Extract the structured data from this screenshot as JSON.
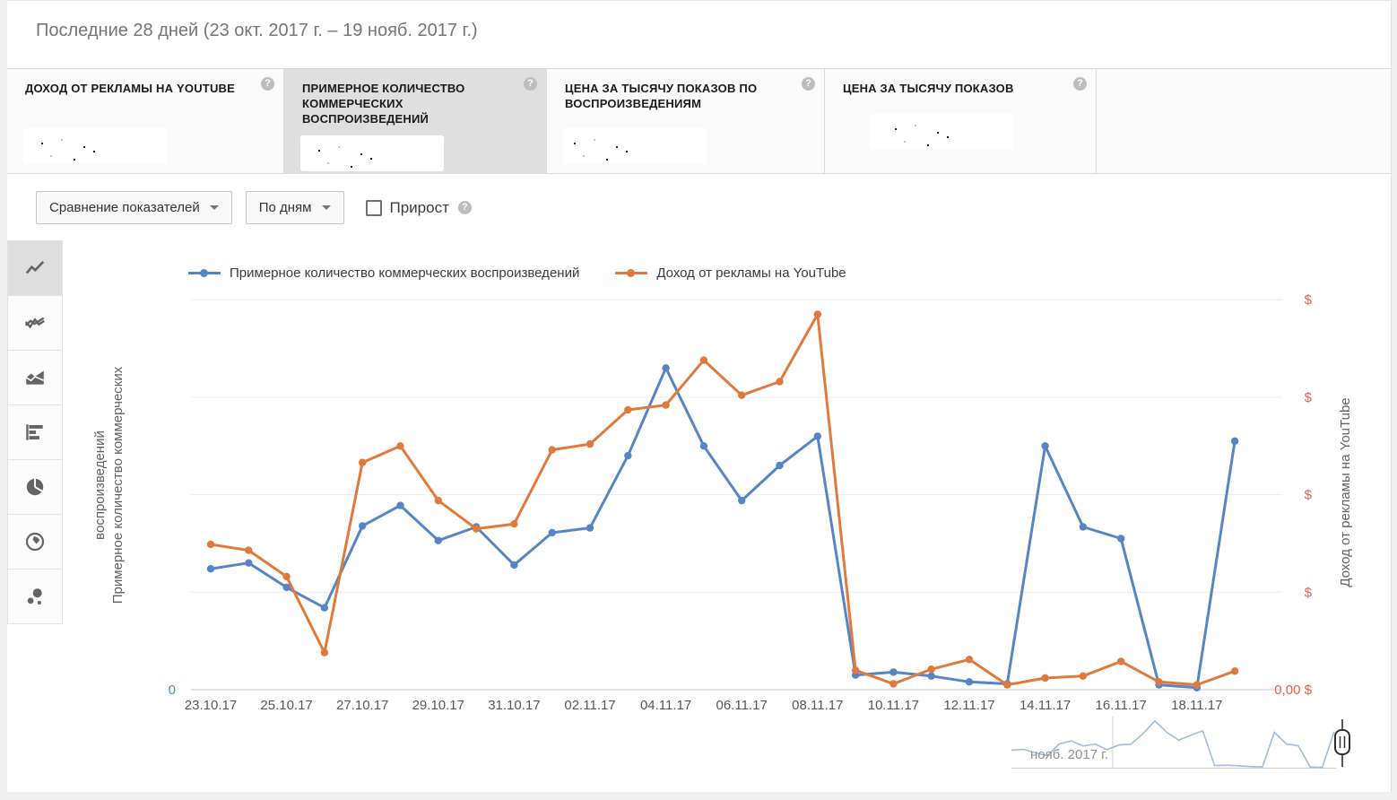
{
  "header": {
    "title": "Последние 28 дней (23 окт. 2017 г. – 19 нояб. 2017 г.)"
  },
  "metric_cards": [
    {
      "label": "ДОХОД ОТ РЕКЛАМЫ НА YOUTUBE",
      "value_hidden": true,
      "active": false
    },
    {
      "label": "ПРИМЕРНОЕ КОЛИЧЕСТВО КОММЕРЧЕСКИХ ВОСПРОИЗВЕДЕНИЙ",
      "value_hidden": true,
      "active": true
    },
    {
      "label": "ЦЕНА ЗА ТЫСЯЧУ ПОКАЗОВ ПО ВОСПРОИЗВЕДЕНИЯМ",
      "value_hidden": true,
      "active": false
    },
    {
      "label": "ЦЕНА ЗА ТЫСЯЧУ ПОКАЗОВ",
      "value_hidden": true,
      "active": false
    }
  ],
  "controls": {
    "compare_label": "Сравнение показателей",
    "period_label": "По дням",
    "growth_label": "Прирост",
    "growth_checked": false
  },
  "sidebar": {
    "items": [
      "line-chart",
      "multi-line-chart",
      "area-chart",
      "bar-chart",
      "pie-chart",
      "geo-map",
      "bubble-chart"
    ],
    "active_index": 0
  },
  "chart_data": {
    "type": "line",
    "x": [
      "23.10.17",
      "24.10.17",
      "25.10.17",
      "26.10.17",
      "27.10.17",
      "28.10.17",
      "29.10.17",
      "30.10.17",
      "31.10.17",
      "01.11.17",
      "02.11.17",
      "03.11.17",
      "04.11.17",
      "05.11.17",
      "06.11.17",
      "07.11.17",
      "08.11.17",
      "09.11.17",
      "10.11.17",
      "11.11.17",
      "12.11.17",
      "13.11.17",
      "14.11.17",
      "15.11.17",
      "16.11.17",
      "17.11.17",
      "18.11.17",
      "19.11.17"
    ],
    "x_tick_labels": [
      "23.10.17",
      "25.10.17",
      "27.10.17",
      "29.10.17",
      "31.10.17",
      "02.11.17",
      "04.11.17",
      "06.11.17",
      "08.11.17",
      "10.11.17",
      "12.11.17",
      "14.11.17",
      "16.11.17",
      "18.11.17"
    ],
    "y_left": {
      "tick_labels": [
        "0"
      ],
      "title": "Примерное количество коммерческих воспроизведений",
      "title_lines": [
        "воспроизведений",
        "Примерное количество коммерческих"
      ]
    },
    "y_right": {
      "tick_labels_top_to_bottom": [
        "$",
        "$",
        "$",
        "$",
        "0,00 $"
      ],
      "title": "Доход от рекламы на YouTube"
    },
    "ylim": [
      0,
      4.4
    ],
    "grid": true,
    "legend_position": "top",
    "values_scale": "relative_gridline_units_actual_numbers_hidden",
    "series": [
      {
        "name": "Примерное количество коммерческих воспроизведений",
        "color": "#5585c5",
        "values": [
          1.24,
          1.3,
          1.05,
          0.84,
          1.68,
          1.89,
          1.53,
          1.67,
          1.28,
          1.61,
          1.66,
          2.4,
          3.3,
          2.5,
          1.94,
          2.3,
          2.6,
          0.15,
          0.18,
          0.14,
          0.08,
          0.06,
          2.5,
          1.67,
          1.55,
          0.05,
          0.02,
          2.55
        ]
      },
      {
        "name": "Доход от рекламы на YouTube",
        "color": "#e0793c",
        "values": [
          1.49,
          1.43,
          1.16,
          0.38,
          2.33,
          2.5,
          1.94,
          1.65,
          1.7,
          2.46,
          2.52,
          2.87,
          2.92,
          3.38,
          3.02,
          3.16,
          3.85,
          0.2,
          0.06,
          0.21,
          0.31,
          0.05,
          0.12,
          0.14,
          0.29,
          0.08,
          0.05,
          0.19
        ]
      }
    ]
  },
  "minimap": {
    "month_label": "нояб. 2017 г."
  },
  "colors": {
    "accent_blue": "#5585c5",
    "accent_orange": "#e0793c",
    "axis_right_text": "#e2604c",
    "axis_left_tick": "#5585c5",
    "gridline": "#ececec",
    "baseline": "#c9c9c9",
    "active_card_bg": "#dfdfdf"
  }
}
